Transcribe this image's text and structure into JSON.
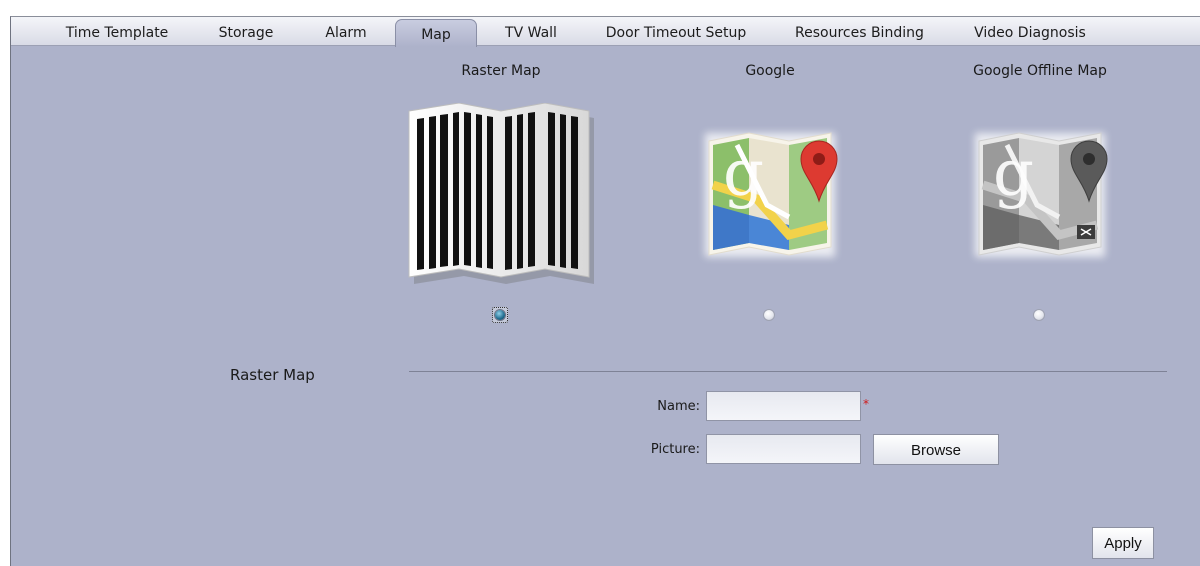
{
  "tabs": [
    {
      "label": "Time Template"
    },
    {
      "label": "Storage"
    },
    {
      "label": "Alarm"
    },
    {
      "label": "Map"
    },
    {
      "label": "TV Wall"
    },
    {
      "label": "Door Timeout Setup"
    },
    {
      "label": "Resources Binding"
    },
    {
      "label": "Video Diagnosis"
    }
  ],
  "active_tab": "Map",
  "map_options": [
    {
      "label": "Raster Map",
      "selected": true
    },
    {
      "label": "Google",
      "selected": false
    },
    {
      "label": "Google Offline Map",
      "selected": false
    }
  ],
  "section": {
    "title": "Raster Map"
  },
  "form": {
    "name_label": "Name:",
    "name_value": "",
    "required_mark": "*",
    "picture_label": "Picture:",
    "picture_value": "",
    "browse_label": "Browse"
  },
  "apply_label": "Apply",
  "colors": {
    "panel_bg": "#adb2ca",
    "required": "#d01818",
    "google_pin": "#dd3a31"
  }
}
